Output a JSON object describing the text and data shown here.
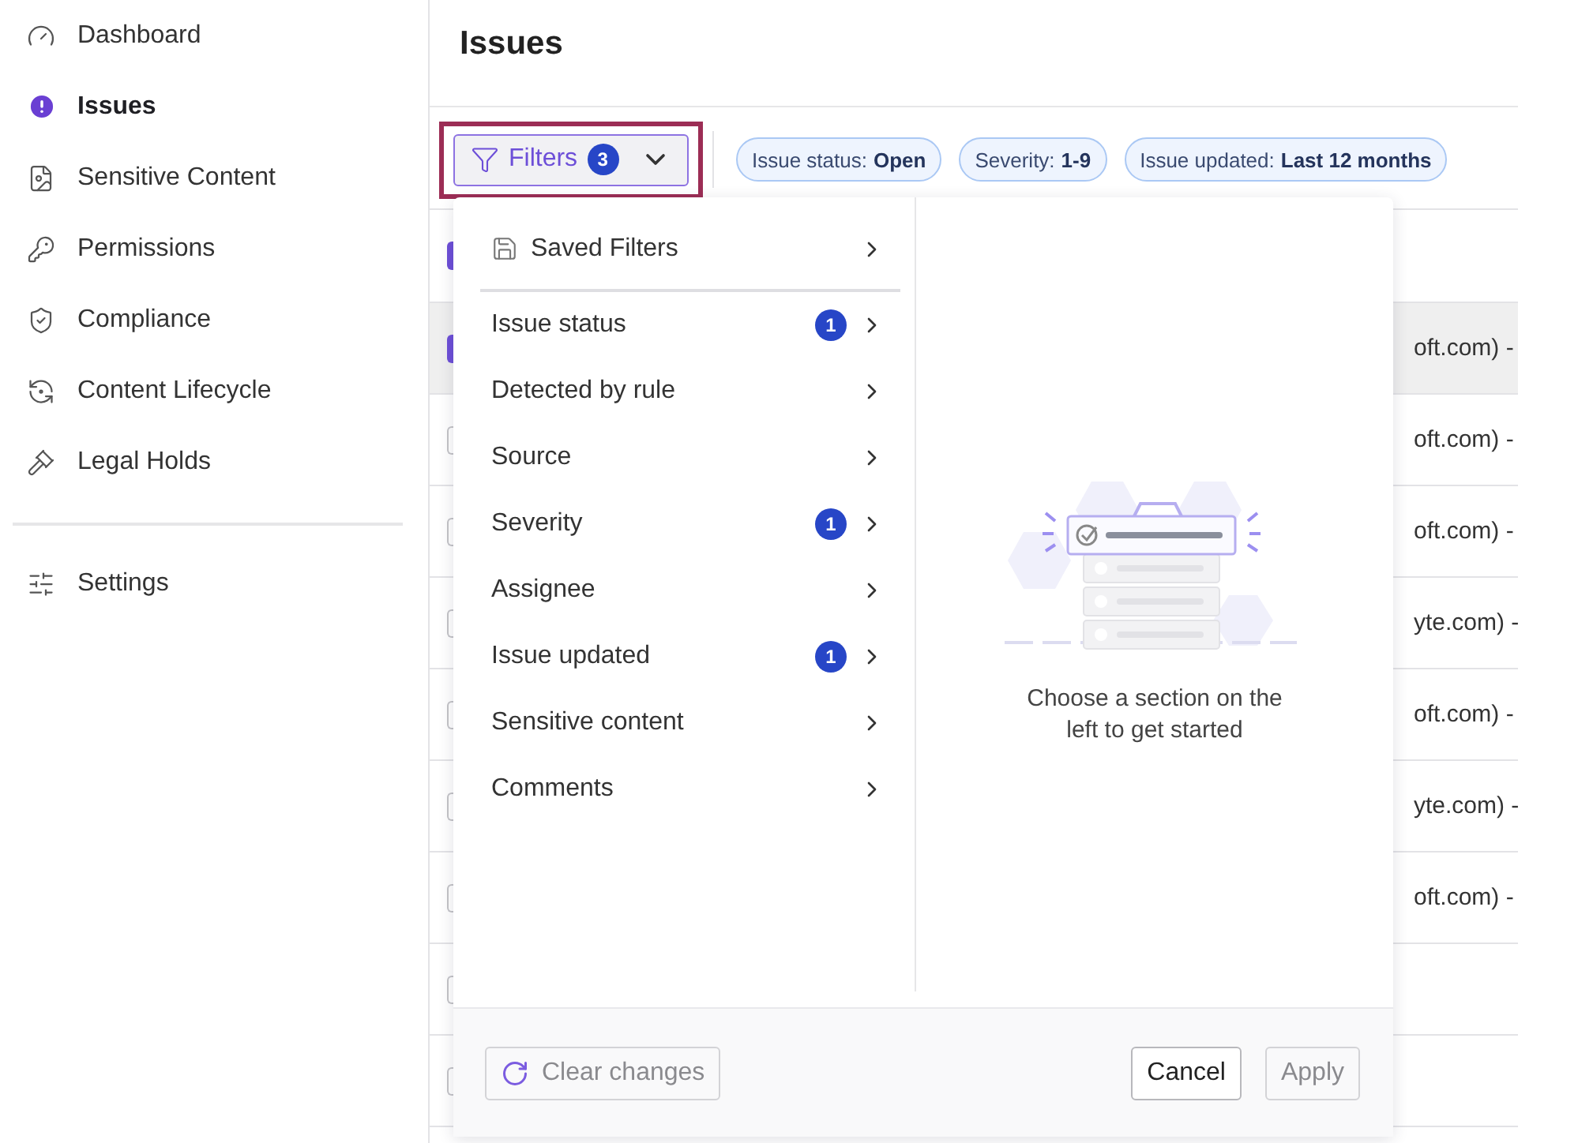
{
  "sidebar": {
    "items": [
      {
        "label": "Dashboard",
        "selected": false
      },
      {
        "label": "Issues",
        "selected": true
      },
      {
        "label": "Sensitive Content",
        "selected": false
      },
      {
        "label": "Permissions",
        "selected": false
      },
      {
        "label": "Compliance",
        "selected": false
      },
      {
        "label": "Content Lifecycle",
        "selected": false
      },
      {
        "label": "Legal Holds",
        "selected": false
      }
    ],
    "footer_items": [
      {
        "label": "Settings",
        "selected": false
      }
    ]
  },
  "page": {
    "title": "Issues"
  },
  "toolbar": {
    "filters_button": {
      "label": "Filters",
      "count": "3",
      "highlighted": true
    },
    "chips": [
      {
        "label": "Issue status:",
        "value": "Open"
      },
      {
        "label": "Severity:",
        "value": "1-9"
      },
      {
        "label": "Issue updated:",
        "value": "Last 12 months"
      }
    ]
  },
  "table": {
    "header": {
      "checked": true
    },
    "rows": [
      {
        "text": "oft.com) -",
        "checked": true,
        "selected": true
      },
      {
        "text": "oft.com) -",
        "checked": false,
        "selected": false
      },
      {
        "text": "oft.com) -",
        "checked": false,
        "selected": false
      },
      {
        "text": "yte.com) -",
        "checked": false,
        "selected": false
      },
      {
        "text": "oft.com) -",
        "checked": false,
        "selected": false
      },
      {
        "text": "yte.com) -",
        "checked": false,
        "selected": false
      },
      {
        "text": "oft.com) -",
        "checked": false,
        "selected": false
      },
      {
        "checked": false,
        "selected": false
      },
      {
        "checked": false,
        "selected": false
      }
    ]
  },
  "filter_menu": {
    "saved": {
      "label": "Saved Filters"
    },
    "sections": [
      {
        "label": "Issue status",
        "count": "1"
      },
      {
        "label": "Detected by rule"
      },
      {
        "label": "Source"
      },
      {
        "label": "Severity",
        "count": "1"
      },
      {
        "label": "Assignee"
      },
      {
        "label": "Issue updated",
        "count": "1"
      },
      {
        "label": "Sensitive content"
      },
      {
        "label": "Comments"
      }
    ],
    "empty_state": {
      "message": "Choose a section on the left to get started"
    },
    "footer": {
      "clear": {
        "label": "Clear changes",
        "disabled": true
      },
      "cancel": {
        "label": "Cancel",
        "disabled": false
      },
      "apply": {
        "label": "Apply",
        "disabled": true
      }
    }
  }
}
